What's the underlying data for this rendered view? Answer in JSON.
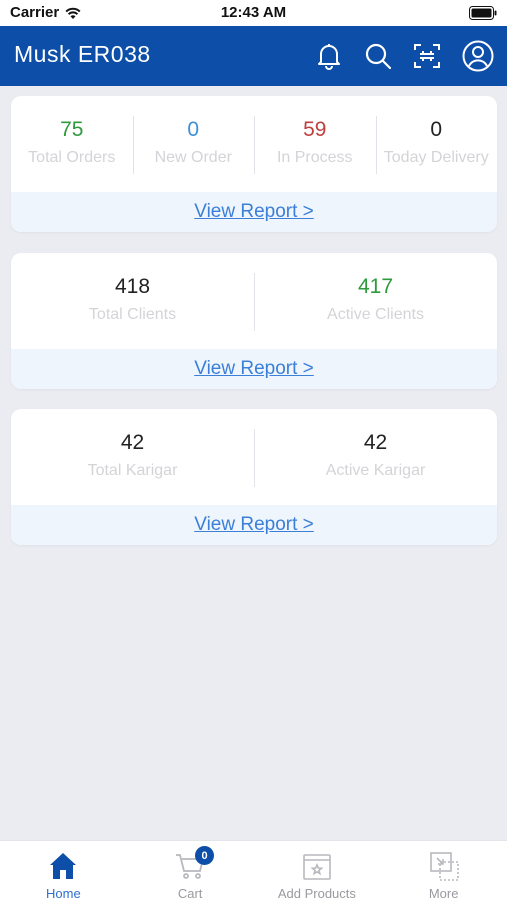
{
  "status_bar": {
    "carrier": "Carrier",
    "time": "12:43 AM"
  },
  "appbar": {
    "title": "Musk ER038"
  },
  "orders_card": {
    "stats": [
      {
        "value": "75",
        "label": "Total Orders",
        "color": "#2e9a3e"
      },
      {
        "value": "0",
        "label": "New Order",
        "color": "#3d8fd8"
      },
      {
        "value": "59",
        "label": "In Process",
        "color": "#c04040"
      },
      {
        "value": "0",
        "label": "Today Delivery",
        "color": "#222222"
      }
    ],
    "link": "View Report >"
  },
  "clients_card": {
    "stats": [
      {
        "value": "418",
        "label": "Total Clients",
        "color": "#222222"
      },
      {
        "value": "417",
        "label": "Active Clients",
        "color": "#2e9a3e"
      }
    ],
    "link": "View Report >"
  },
  "karigar_card": {
    "stats": [
      {
        "value": "42",
        "label": "Total Karigar",
        "color": "#222222"
      },
      {
        "value": "42",
        "label": "Active Karigar",
        "color": "#222222"
      }
    ],
    "link": "View Report >"
  },
  "tabbar": {
    "tabs": [
      {
        "label": "Home",
        "icon": "home-icon",
        "active": true
      },
      {
        "label": "Cart",
        "icon": "cart-icon",
        "badge": "0"
      },
      {
        "label": "Add Products",
        "icon": "add-products-icon"
      },
      {
        "label": "More",
        "icon": "more-icon"
      }
    ]
  },
  "colors": {
    "primary": "#0d4ea8",
    "link": "#3b7fd8",
    "background": "#ebebf2"
  }
}
